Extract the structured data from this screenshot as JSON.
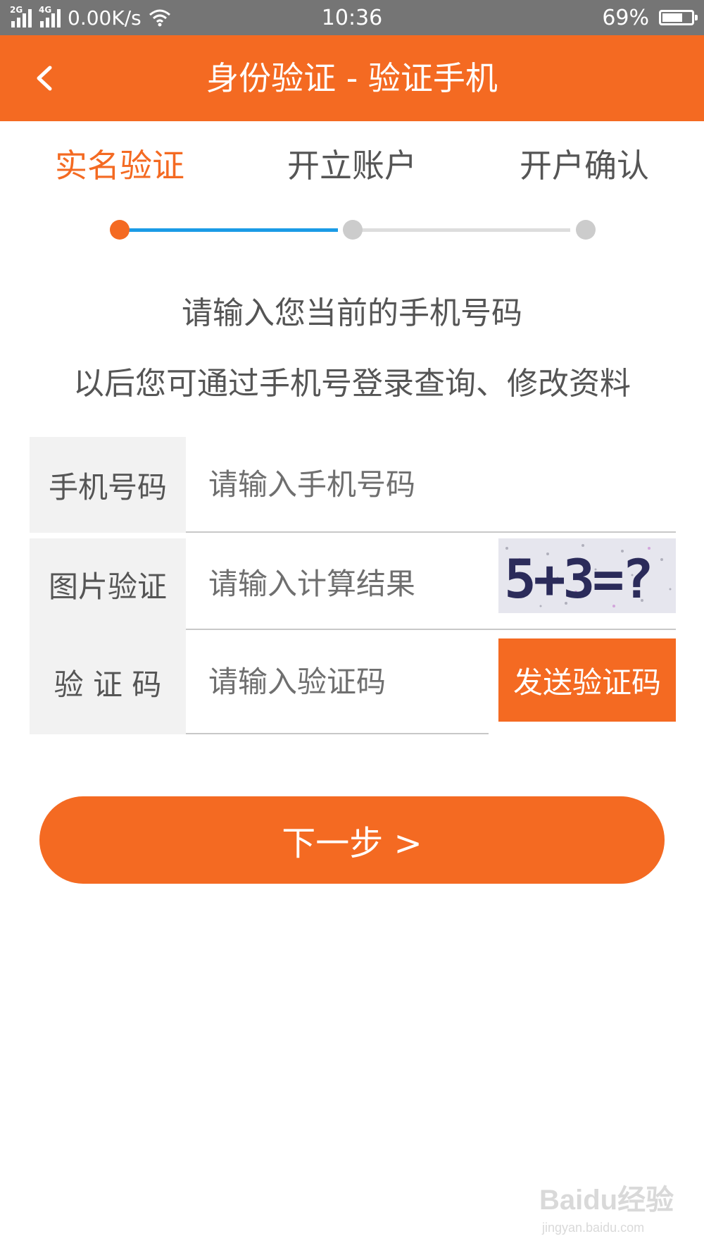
{
  "status_bar": {
    "net_2g": "2G",
    "net_4g": "4G",
    "speed": "0.00K/s",
    "time": "10:36",
    "battery_text": "69%",
    "battery_level": 0.69
  },
  "header": {
    "title": "身份验证 - 验证手机"
  },
  "steps": [
    {
      "label": "实名验证",
      "active": true
    },
    {
      "label": "开立账户",
      "active": false
    },
    {
      "label": "开户确认",
      "active": false
    }
  ],
  "instructions": {
    "line1": "请输入您当前的手机号码",
    "line2": "以后您可通过手机号登录查询、修改资料"
  },
  "form": {
    "phone": {
      "label": "手机号码",
      "placeholder": "请输入手机号码",
      "value": ""
    },
    "captcha": {
      "label": "图片验证",
      "placeholder": "请输入计算结果",
      "value": "",
      "image_text": "5+3=?"
    },
    "sms": {
      "label": "验 证 码",
      "placeholder": "请输入验证码",
      "value": "",
      "send_button": "发送验证码"
    }
  },
  "next_button": "下一步 >",
  "watermark": {
    "main": "Baidu经验",
    "sub": "jingyan.baidu.com"
  },
  "colors": {
    "accent": "#f46a22",
    "progress_blue": "#1b9be6",
    "status_bar": "#757575"
  }
}
